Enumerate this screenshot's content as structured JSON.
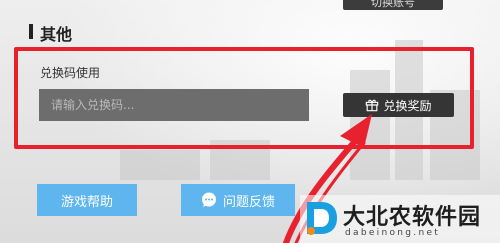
{
  "top_button": {
    "label": "切换账号"
  },
  "section": {
    "title": "其他"
  },
  "redeem": {
    "label": "兑换码使用",
    "placeholder": "请输入兑换码...",
    "button_label": "兑换奖励"
  },
  "bottom_buttons": {
    "help_label": "游戏帮助",
    "feedback_label": "问题反馈"
  },
  "watermark": {
    "name_cn": "大北农软件园",
    "domain": "dabeinong.net"
  },
  "colors": {
    "highlight": "#e8212e",
    "primary_button": "#5fb6ef",
    "dark_button": "#353535"
  },
  "icons": [
    "gift-icon",
    "chat-bubble-icon",
    "red-arrow-annotation",
    "watermark-logo"
  ]
}
